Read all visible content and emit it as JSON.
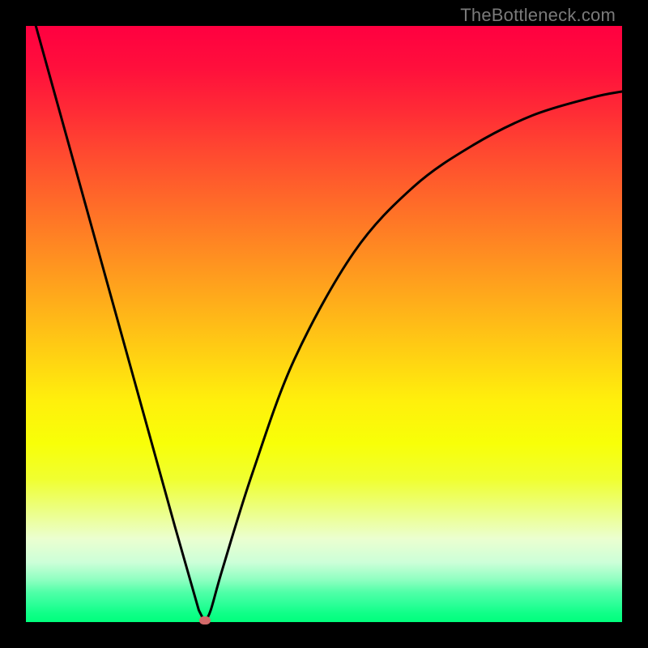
{
  "watermark": "TheBottleneck.com",
  "colors": {
    "frame": "#000000",
    "marker": "#d46a6a",
    "gradient_top": "#ff0040",
    "gradient_bottom": "#00ff7c",
    "curve": "#000000"
  },
  "chart_data": {
    "type": "line",
    "title": "",
    "xlabel": "",
    "ylabel": "",
    "series": [
      {
        "name": "bottleneck-curve",
        "x": [
          0.0,
          0.05,
          0.1,
          0.15,
          0.2,
          0.25,
          0.29,
          0.3,
          0.31,
          0.33,
          0.38,
          0.45,
          0.55,
          0.65,
          0.75,
          0.85,
          0.95,
          1.0
        ],
        "y": [
          1.06,
          0.88,
          0.7,
          0.52,
          0.34,
          0.16,
          0.02,
          0.0,
          0.02,
          0.09,
          0.25,
          0.44,
          0.62,
          0.73,
          0.8,
          0.85,
          0.88,
          0.89
        ]
      }
    ],
    "xlim": [
      0,
      1
    ],
    "ylim": [
      0,
      1
    ],
    "marker": {
      "x": 0.3,
      "y": 0.0
    }
  }
}
